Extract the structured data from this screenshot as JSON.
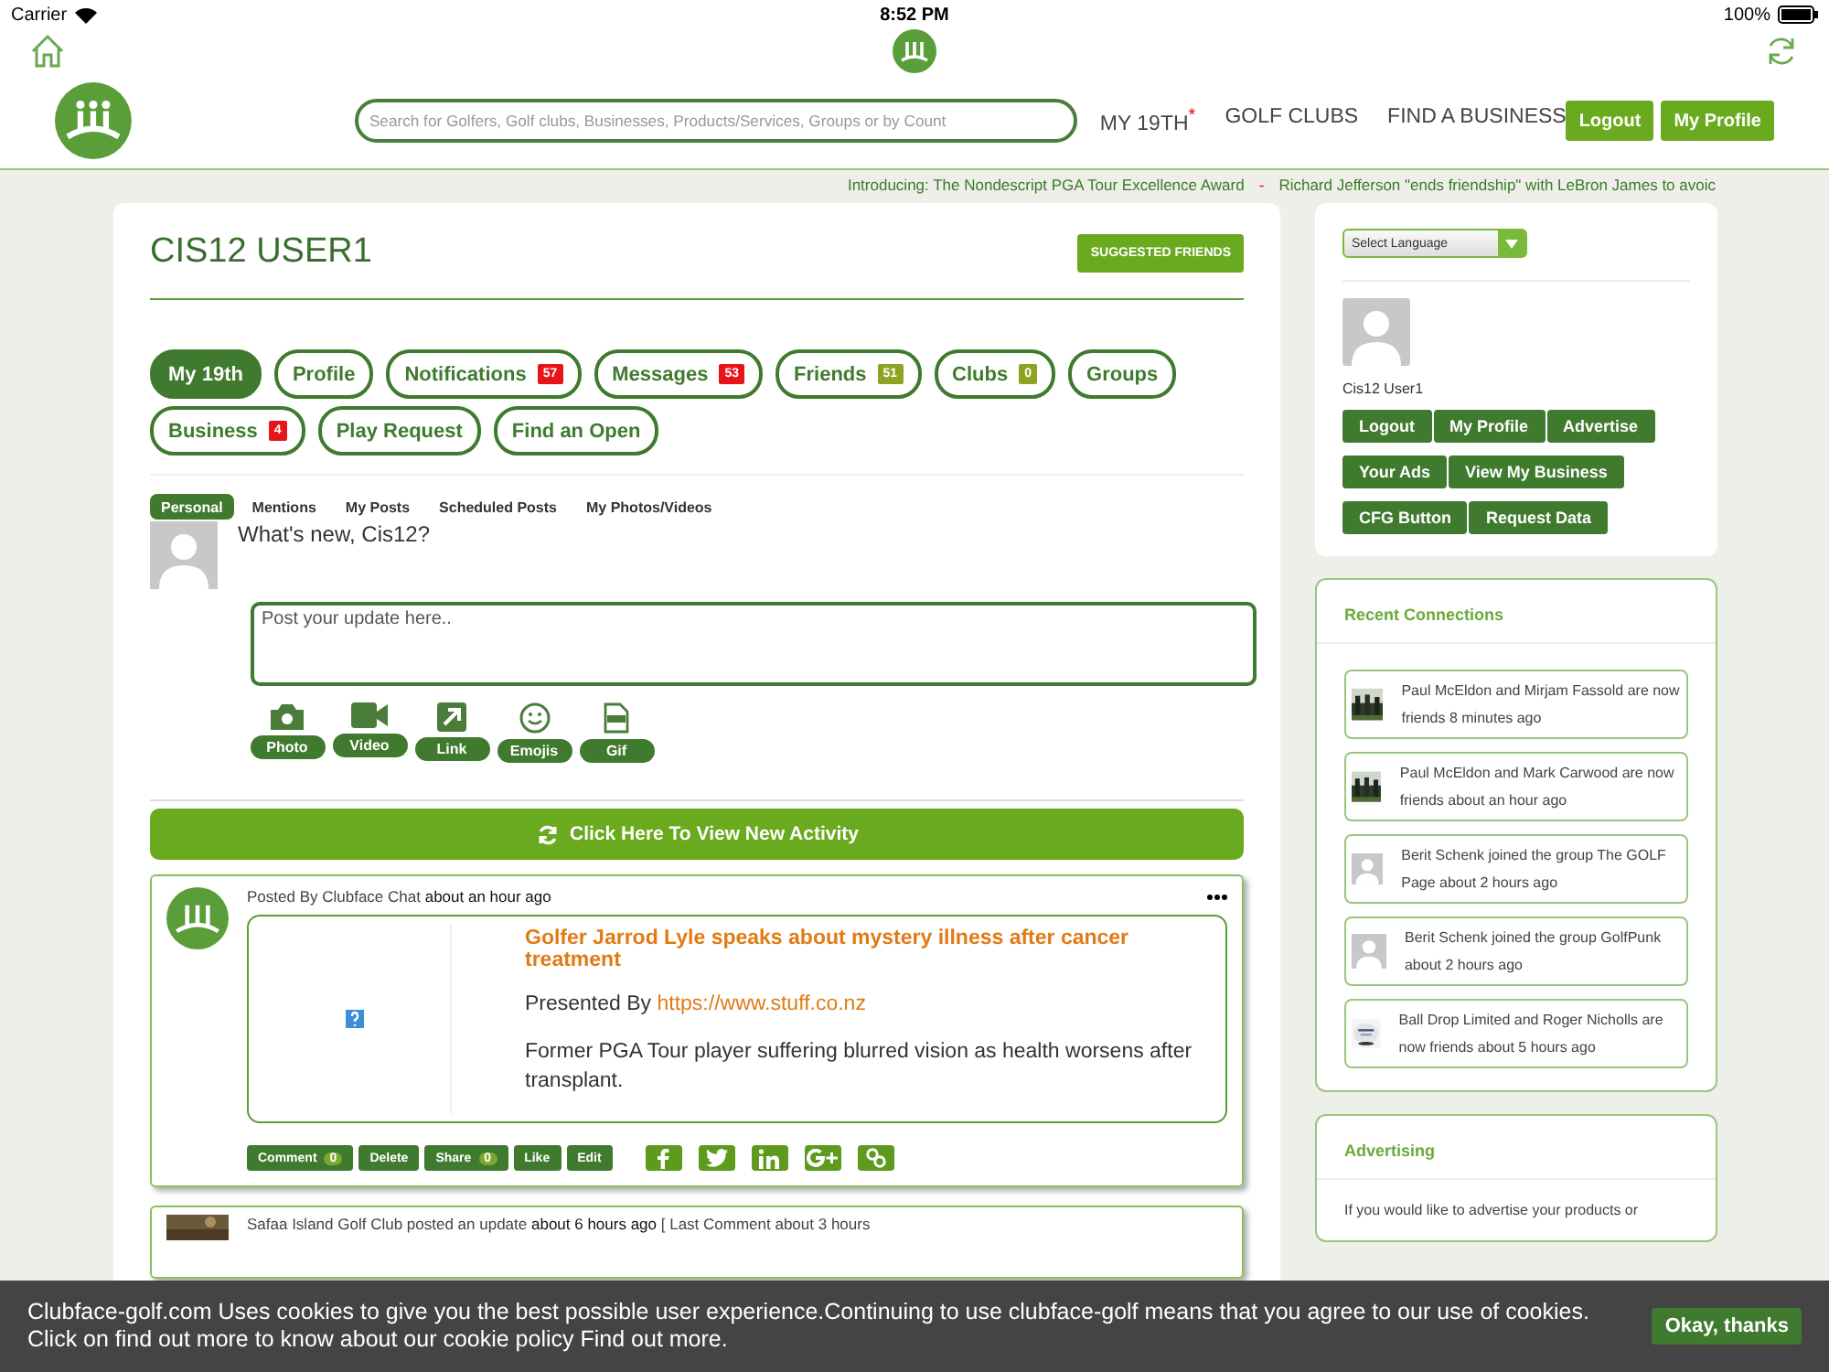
{
  "status_bar": {
    "carrier": "Carrier",
    "time": "8:52 PM",
    "battery": "100%"
  },
  "header": {
    "search_placeholder": "Search for Golfers, Golf clubs, Businesses, Products/Services, Groups or by Count",
    "nav": [
      {
        "label": "MY 19TH",
        "marker": "*"
      },
      {
        "label": "GOLF CLUBS"
      },
      {
        "label": "FIND A BUSINESS"
      }
    ],
    "buttons": [
      "Logout",
      "My Profile"
    ]
  },
  "ticker": {
    "items": [
      "Introducing: The Nondescript PGA Tour Excellence Award",
      "Richard Jefferson \"ends friendship\" with LeBron James to avoic"
    ],
    "separator": "-"
  },
  "profile": {
    "name": "CIS12 USER1",
    "suggested_button": "SUGGESTED FRIENDS",
    "tabs": [
      {
        "label": "My 19th",
        "selected": true
      },
      {
        "label": "Profile",
        "selected": false
      },
      {
        "label": "Notifications",
        "badge": "57",
        "color": "#e8141b",
        "selected": false
      },
      {
        "label": "Messages",
        "badge": "53",
        "color": "#e8141b",
        "selected": false
      },
      {
        "label": "Friends",
        "badge": "51",
        "color": "#8fa323",
        "selected": false
      },
      {
        "label": "Clubs",
        "badge": "0",
        "color": "#8fa323",
        "selected": false
      },
      {
        "label": "Groups",
        "selected": false
      },
      {
        "label": "Business",
        "badge": "4",
        "color": "#e8141b",
        "selected": false
      },
      {
        "label": "Play Request",
        "selected": false
      },
      {
        "label": "Find an Open",
        "selected": false
      }
    ]
  },
  "feed_tabs": [
    {
      "label": "Personal",
      "selected": true
    },
    {
      "label": "Mentions",
      "selected": false
    },
    {
      "label": "My Posts",
      "selected": false
    },
    {
      "label": "Scheduled Posts",
      "selected": false
    },
    {
      "label": "My Photos/Videos",
      "selected": false
    }
  ],
  "composer": {
    "prompt": "What's new, Cis12?",
    "placeholder": "Post your update here..",
    "media": [
      {
        "label": "Photo",
        "kind": "camera"
      },
      {
        "label": "Video",
        "kind": "video"
      },
      {
        "label": "Link",
        "kind": "link"
      },
      {
        "label": "Emojis",
        "kind": "emoji"
      },
      {
        "label": "Gif",
        "kind": "gif"
      }
    ]
  },
  "new_activity": "Click Here To View New Activity",
  "post": {
    "byline": "Posted By Clubface Chat **about an hour ago**",
    "title": "Golfer Jarrod Lyle speaks about mystery illness after cancer treatment",
    "presented_by": "Presented By",
    "url": "https://www.stuff.co.nz",
    "summary": "Former PGA Tour player suffering blurred vision as health worsens after transplant.",
    "actions": [
      {
        "label": "Comment",
        "count": "0"
      },
      {
        "label": "Delete"
      },
      {
        "label": "Share",
        "count": "0"
      },
      {
        "label": "Like"
      },
      {
        "label": "Edit"
      }
    ],
    "shares": [
      {
        "kind": "facebook"
      },
      {
        "kind": "twitter"
      },
      {
        "kind": "linkedin"
      },
      {
        "kind": "googleplus"
      },
      {
        "kind": "link"
      }
    ]
  },
  "next_post": {
    "byline": "Safaa Island Golf Club posted an update **about 6 hours ago** [ Last Comment about 3 hours"
  },
  "sidebar": {
    "language": "Select Language",
    "user": "Cis12 User1",
    "buttons": [
      [
        "Logout",
        "My Profile",
        "Advertise"
      ],
      [
        "Your Ads",
        "View My Business"
      ],
      [
        "CFG Button",
        "Request Data"
      ]
    ],
    "connections_title": "Recent Connections",
    "connections": [
      {
        "text": "Paul McEldon and Mirjam Fassold are now friends 8 minutes ago"
      },
      {
        "text": "Paul McEldon and Mark Carwood are now friends about an hour ago"
      },
      {
        "text": "Berit Schenk joined the group The GOLF Page about 2 hours ago",
        "kind": "default"
      },
      {
        "text": "Berit Schenk joined the group GolfPunk about 2 hours ago",
        "kind": "default"
      },
      {
        "text": "Ball Drop Limited and Roger Nicholls are now friends about 5 hours ago",
        "kind": "logo"
      }
    ],
    "advertising_title": "Advertising",
    "advertising_text": "If you would like to advertise your products or"
  },
  "cookie": {
    "text": "Clubface-golf.com Uses cookies to give you the best possible user experience.Continuing to use clubface-golf means that you agree to our use of cookies. Click on find out more to know about our cookie policy",
    "link": "Find out more.",
    "button": "Okay, thanks"
  }
}
